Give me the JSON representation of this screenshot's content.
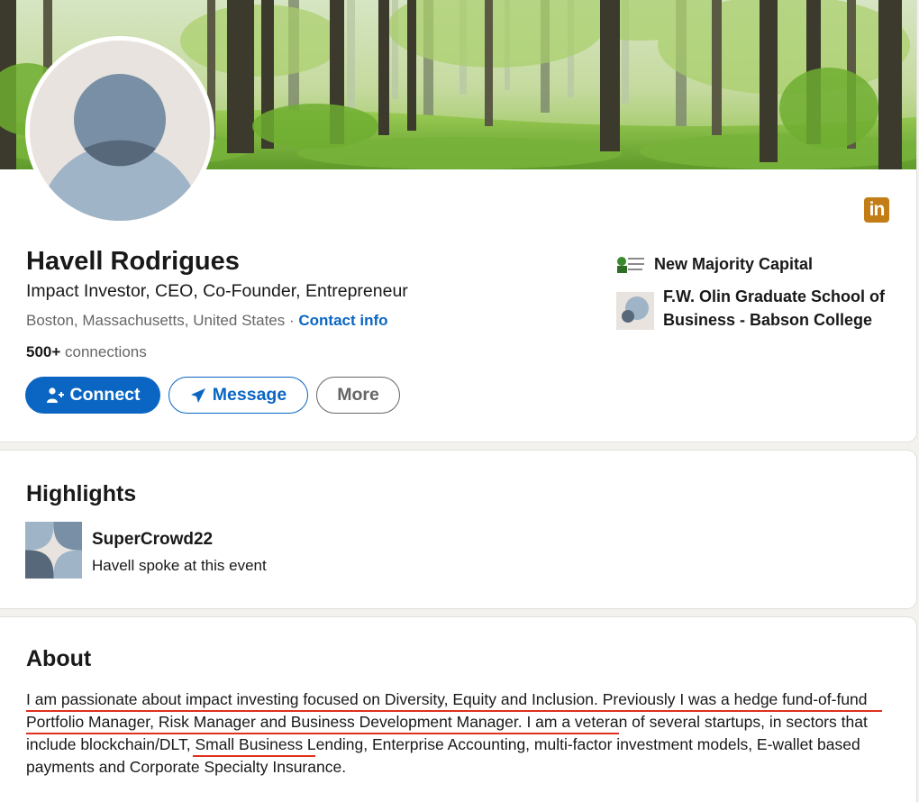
{
  "profile": {
    "name": "Havell Rodrigues",
    "headline": "Impact Investor, CEO, Co-Founder, Entrepreneur",
    "location": "Boston, Massachusetts, United States",
    "separator": " · ",
    "contact_info_label": "Contact info",
    "connections_count": "500+",
    "connections_label": " connections"
  },
  "actions": {
    "connect_label": "Connect",
    "message_label": "Message",
    "more_label": "More"
  },
  "brand": {
    "linkedin_logo_text": "in",
    "linkedin_logo_color": "#c37d16",
    "primary_blue": "#0a66c2"
  },
  "organizations": [
    {
      "name": "New Majority Capital",
      "logo_text": "New Majority Capital",
      "icon": "new-majority-capital-logo"
    },
    {
      "name": "F.W. Olin Graduate School of Business - Babson College",
      "icon": "school-placeholder-logo"
    }
  ],
  "highlights": {
    "title": "Highlights",
    "items": [
      {
        "name": "SuperCrowd22",
        "description": "Havell spoke at this event",
        "icon": "event-thumbnail"
      }
    ]
  },
  "about": {
    "title": "About",
    "text_part1": "I am passionate about impact investing focused on Diversity, Equity and Inclusion. Previously I was a hedge fund-of-fund Portfolio Manager, Risk Manager and Business Development Manager.",
    "text_part2": " I am a veteran of several startups, in sectors that include ",
    "text_part3": "blockchain/DLT,",
    "text_part4": " Small Business Lending, Enterprise Accounting, multi-factor investment models, E-wallet based payments and Corporate Specialty Insurance.",
    "annotation_color": "#e0301e"
  }
}
